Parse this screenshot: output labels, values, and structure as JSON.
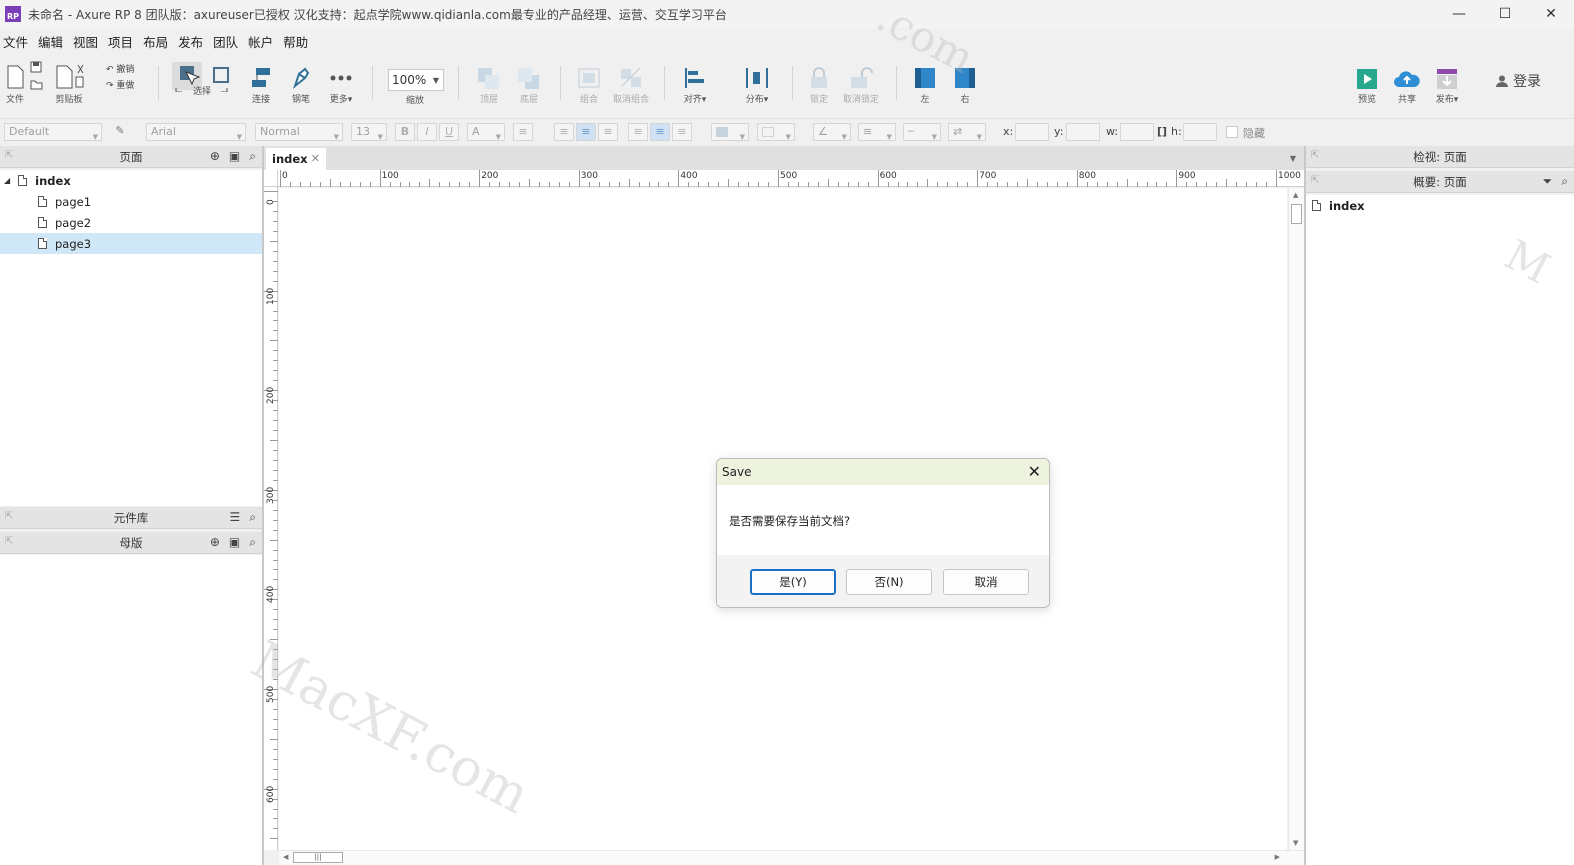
{
  "window": {
    "title": "未命名 - Axure RP 8 团队版：axureuser已授权 汉化支持：起点学院www.qidianla.com最专业的产品经理、运营、交互学习平台",
    "logo_text": "RP",
    "minimize": "—",
    "maximize": "☐",
    "close": "✕"
  },
  "menu": [
    "文件",
    "编辑",
    "视图",
    "项目",
    "布局",
    "发布",
    "团队",
    "帐户",
    "帮助"
  ],
  "toolbar": {
    "file": "文件",
    "clipboard": "剪贴板",
    "undo": "撤销",
    "redo": "重做",
    "select": "选择",
    "connect": "连接",
    "pen": "钢笔",
    "more": "更多▾",
    "zoom_value": "100%",
    "zoom_label": "缩放",
    "top": "顶层",
    "bottom": "底层",
    "group": "组合",
    "ungroup": "取消组合",
    "align": "对齐▾",
    "distribute": "分布▾",
    "lock": "锁定",
    "unlock": "取消锁定",
    "left": "左",
    "right": "右",
    "preview": "预览",
    "share": "共享",
    "publish": "发布▾",
    "login": "登录"
  },
  "formatbar": {
    "style": "Default",
    "font": "Arial",
    "weight": "Normal",
    "size": "13",
    "bold": "B",
    "italic": "I",
    "underline": "U",
    "font_color": "A",
    "x_label": "x:",
    "y_label": "y:",
    "w_label": "w:",
    "h_label": "h:",
    "hide_label": "隐藏"
  },
  "pages_panel": {
    "title": "页面",
    "root": "index",
    "children": [
      "page1",
      "page2",
      "page3"
    ],
    "selected": "page3"
  },
  "widgets_panel": {
    "title": "元件库"
  },
  "masters_panel": {
    "title": "母版"
  },
  "canvas": {
    "tab": "index",
    "ruler_h": [
      "0",
      "100",
      "200",
      "300",
      "400",
      "500",
      "600",
      "700",
      "800",
      "900",
      "1000"
    ],
    "ruler_v": [
      "0",
      "100",
      "200",
      "300",
      "400",
      "500",
      "600"
    ]
  },
  "inspector": {
    "title": "检视: 页面"
  },
  "outline": {
    "title": "概要: 页面",
    "item": "index"
  },
  "dialog": {
    "title": "Save",
    "message": "是否需要保存当前文档?",
    "yes": "是(Y)",
    "no": "否(N)",
    "cancel": "取消"
  },
  "watermarks": [
    "MacXF.com",
    ".com",
    "M"
  ],
  "colors": {
    "selected_row": "#cfe7f6",
    "dialog_title_bg": "#eef3df",
    "primary_border": "#1a6fc9",
    "accent_blue": "#2f86c9",
    "preview_green": "#27a88c",
    "share_blue": "#2e8fd6",
    "publish_purple": "#8e4aa8"
  }
}
